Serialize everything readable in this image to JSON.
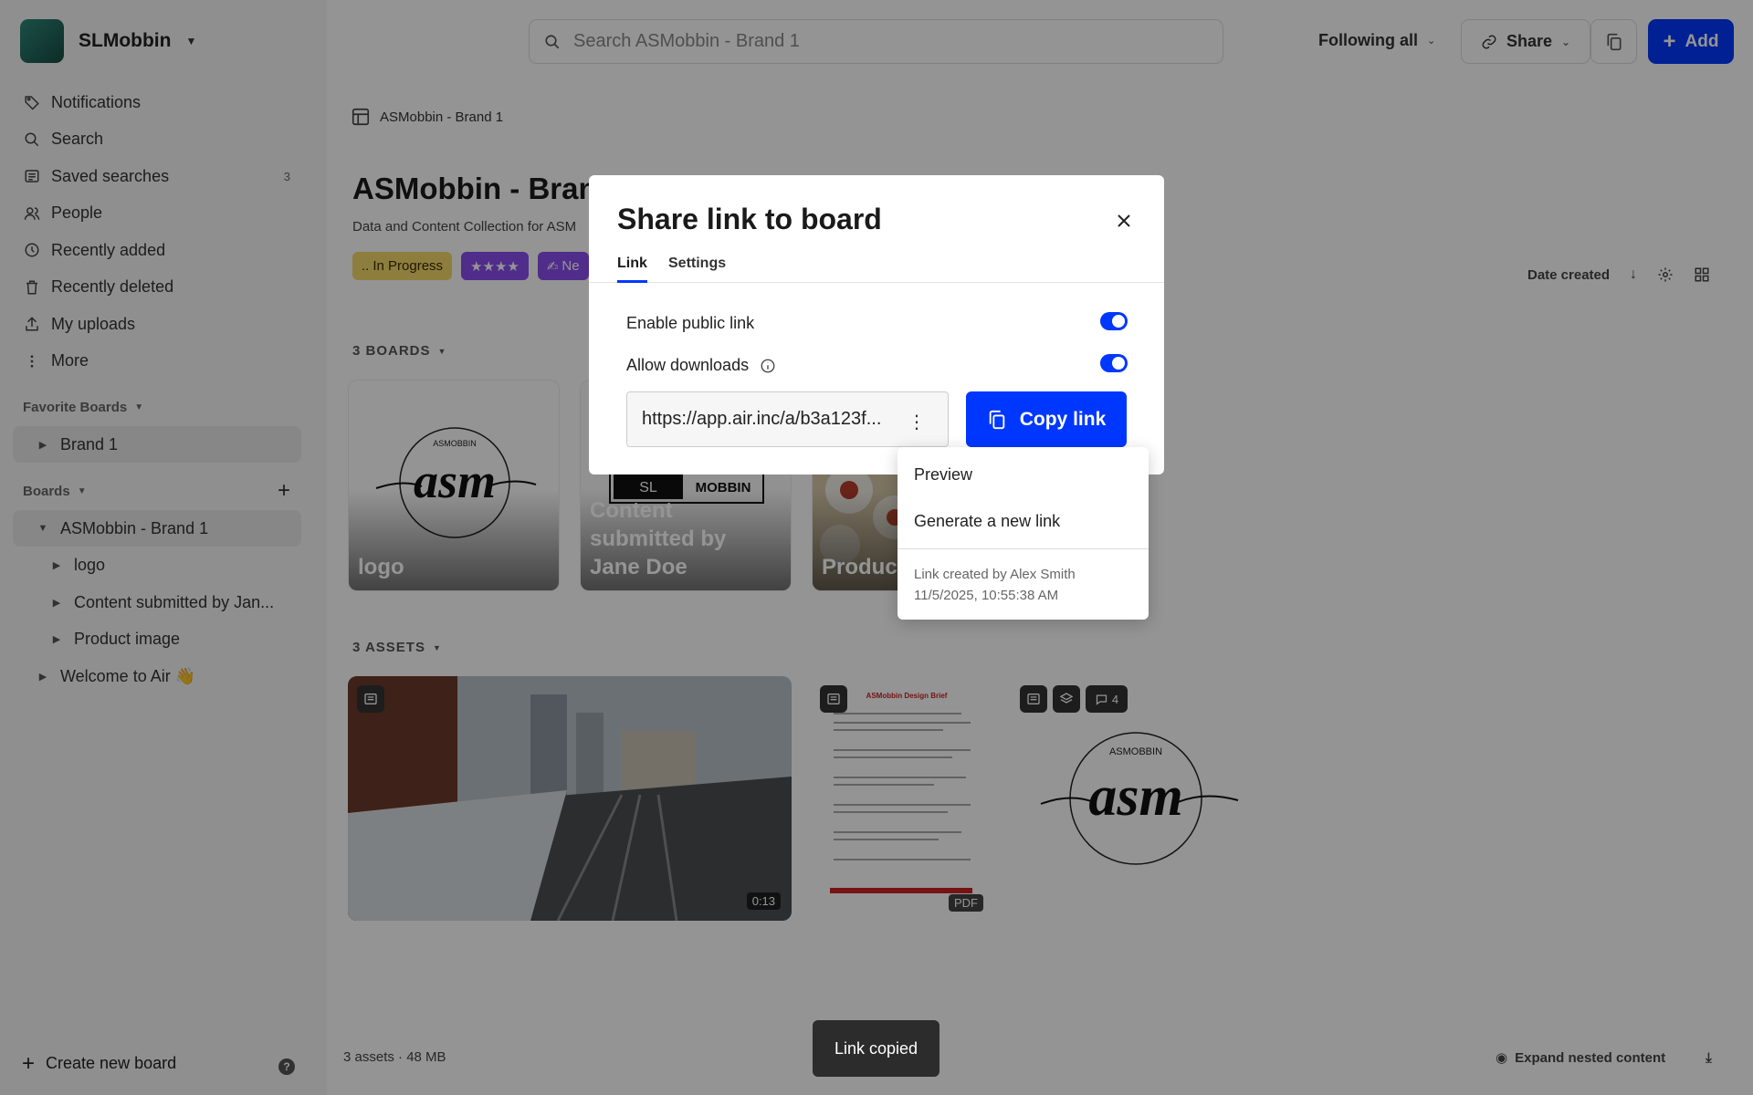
{
  "workspace": {
    "name": "SLMobbin"
  },
  "sidebar": {
    "nav": [
      {
        "label": "Notifications",
        "icon": "tag-icon"
      },
      {
        "label": "Search",
        "icon": "search-icon"
      },
      {
        "label": "Saved searches",
        "icon": "saved-searches-icon",
        "count": "3"
      },
      {
        "label": "People",
        "icon": "people-icon"
      },
      {
        "label": "Recently added",
        "icon": "clock-icon"
      },
      {
        "label": "Recently deleted",
        "icon": "trash-icon"
      },
      {
        "label": "My uploads",
        "icon": "upload-icon"
      },
      {
        "label": "More",
        "icon": "more-icon"
      }
    ],
    "favorite_label": "Favorite Boards",
    "favorites": [
      "Brand 1"
    ],
    "boards_label": "Boards",
    "boards": [
      {
        "label": "ASMobbin - Brand 1"
      },
      {
        "label": "logo"
      },
      {
        "label": "Content submitted by Jan..."
      },
      {
        "label": "Product image"
      },
      {
        "label": "Welcome to Air 👋"
      }
    ],
    "create_label": "Create new board",
    "help": "?"
  },
  "topbar": {
    "search_placeholder": "Search ASMobbin - Brand 1",
    "following": "Following all",
    "share": "Share",
    "add": "Add"
  },
  "board": {
    "breadcrumb": "ASMobbin - Brand 1",
    "title": "ASMobbin - Brand",
    "description": "Data and Content Collection for ASM",
    "tags": [
      "In Progress",
      "★★★★",
      "Ne"
    ],
    "sort": "Date created",
    "boards_header": "3 BOARDS",
    "assets_header": "3 ASSETS",
    "cards": [
      {
        "label": "logo"
      },
      {
        "label": "Content submitted by Jane Doe"
      },
      {
        "label": "Product"
      }
    ],
    "video_duration": "0:13",
    "pdf_label": "PDF",
    "brief_title": "ASMobbin Design Brief",
    "comment_count": "4",
    "logo_small": "ASMOBBIN",
    "logo_script": "asm",
    "sl_text": "SL",
    "mobbin_text": "MOBBIN",
    "footer_left": "3 assets · 48 MB",
    "footer_right": "Expand nested content"
  },
  "modal": {
    "title": "Share link to board",
    "tabs": [
      "Link",
      "Settings"
    ],
    "enable_label": "Enable public link",
    "downloads_label": "Allow downloads",
    "url": "https://app.air.inc/a/b3a123f...",
    "copy_label": "Copy link"
  },
  "menu": {
    "items": [
      "Preview",
      "Generate a new link"
    ],
    "meta_line1": "Link created by Alex Smith",
    "meta_line2": "11/5/2025, 10:55:38 AM"
  },
  "toast": "Link copied",
  "colors": {
    "accent": "#0037ff",
    "tag_yellow": "#f5d96b",
    "tag_purple": "#8a4cf0"
  }
}
